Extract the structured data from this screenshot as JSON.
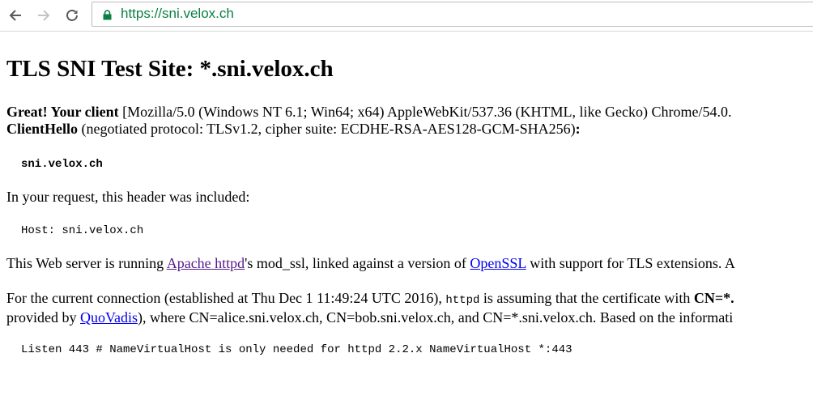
{
  "browser": {
    "url": "https://sni.velox.ch",
    "colors": {
      "url": "#0b8043",
      "lock": "#0b8043"
    }
  },
  "page": {
    "title": "TLS SNI Test Site: *.sni.velox.ch",
    "p1": {
      "great": "Great! Your client",
      "ua": " [Mozilla/5.0 (Windows NT 6.1; Win64; x64) AppleWebKit/537.36 (KHTML, like Gecko) Chrome/54.0.",
      "clienthello": "ClientHello",
      "negotiated": " (negotiated protocol: TLSv1.2, cipher suite: ECDHE-RSA-AES128-GCM-SHA256)",
      "colon": ":"
    },
    "sni_name": "sni.velox.ch",
    "p2": "In your request, this header was included:",
    "host_header": "Host: sni.velox.ch",
    "p3": {
      "before": "This Web server is running ",
      "apache_link": "Apache httpd",
      "middle": "'s mod_ssl, linked against a version of ",
      "openssl_link": "OpenSSL",
      "after": " with support for TLS extensions. A"
    },
    "p4": {
      "line1_before": "For the current connection (established at Thu Dec 1 11:49:24 UTC 2016), ",
      "httpd_code": "httpd",
      "line1_after": " is assuming that the certificate with ",
      "cn_bold": "CN=*.",
      "line2_before": "provided by ",
      "quovadis_link": "QuoVadis",
      "line2_after": "), where CN=alice.sni.velox.ch, CN=bob.sni.velox.ch, and CN=*.sni.velox.ch. Based on the informati"
    },
    "config_lines": [
      "Listen 443",
      "# NameVirtualHost is only needed for httpd 2.2.x",
      "NameVirtualHost *:443"
    ]
  }
}
